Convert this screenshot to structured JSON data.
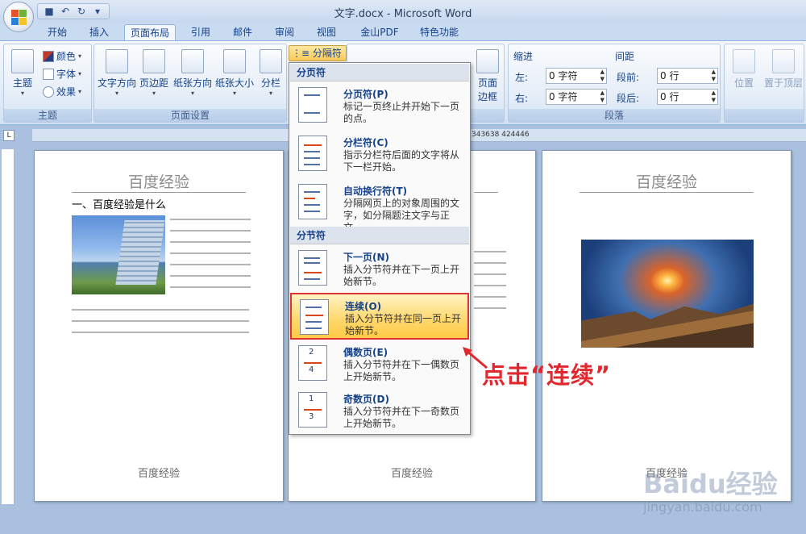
{
  "window": {
    "title": "文字.docx - Microsoft Word"
  },
  "tabs": [
    "开始",
    "插入",
    "页面布局",
    "引用",
    "邮件",
    "审阅",
    "视图",
    "金山PDF",
    "特色功能"
  ],
  "active_tab": "页面布局",
  "ribbon": {
    "theme": {
      "label": "主题",
      "big": "主题",
      "colors": "颜色",
      "fonts": "字体",
      "effects": "效果"
    },
    "page_setup": {
      "label": "页面设置",
      "direction": "文字方向",
      "margins": "页边距",
      "orientation": "纸张方向",
      "size": "纸张大小",
      "columns": "分栏",
      "breaks": "分隔符"
    },
    "page_bg": {
      "border": "页面",
      "border2": "边框"
    },
    "paragraph": {
      "label": "段落",
      "indent_title": "缩进",
      "spacing_title": "间距",
      "left_label": "左:",
      "left_value": "0 字符",
      "right_label": "右:",
      "right_value": "0 字符",
      "before_label": "段前:",
      "before_value": "0 行",
      "after_label": "段后:",
      "after_value": "0 行"
    },
    "arrange": {
      "position": "位置",
      "front": "置于顶层"
    }
  },
  "ruler_text": "343638 424446",
  "pages": {
    "header": "百度经验",
    "footer": "百度经验",
    "p1_heading": "一、百度经验是什么"
  },
  "menu": {
    "button": "分隔符",
    "section_page": "分页符",
    "section_section": "分节符",
    "items": [
      {
        "title": "分页符(P)",
        "desc": "标记一页终止并开始下一页的点。"
      },
      {
        "title": "分栏符(C)",
        "desc": "指示分栏符后面的文字将从下一栏开始。"
      },
      {
        "title": "自动换行符(T)",
        "desc": "分隔网页上的对象周围的文字，如分隔题注文字与正文。"
      },
      {
        "title": "下一页(N)",
        "desc": "插入分节符并在下一页上开始新节。"
      },
      {
        "title": "连续(O)",
        "desc": "插入分节符并在同一页上开始新节。"
      },
      {
        "title": "偶数页(E)",
        "desc": "插入分节符并在下一偶数页上开始新节。"
      },
      {
        "title": "奇数页(D)",
        "desc": "插入分节符并在下一奇数页上开始新节。"
      }
    ]
  },
  "annotation": "点击“连续”",
  "watermark": {
    "brand": "Baidu经验",
    "url": "jingyan.baidu.com"
  },
  "colors": {
    "accent": "#e03232",
    "ribbon": "#dfe9f5"
  }
}
